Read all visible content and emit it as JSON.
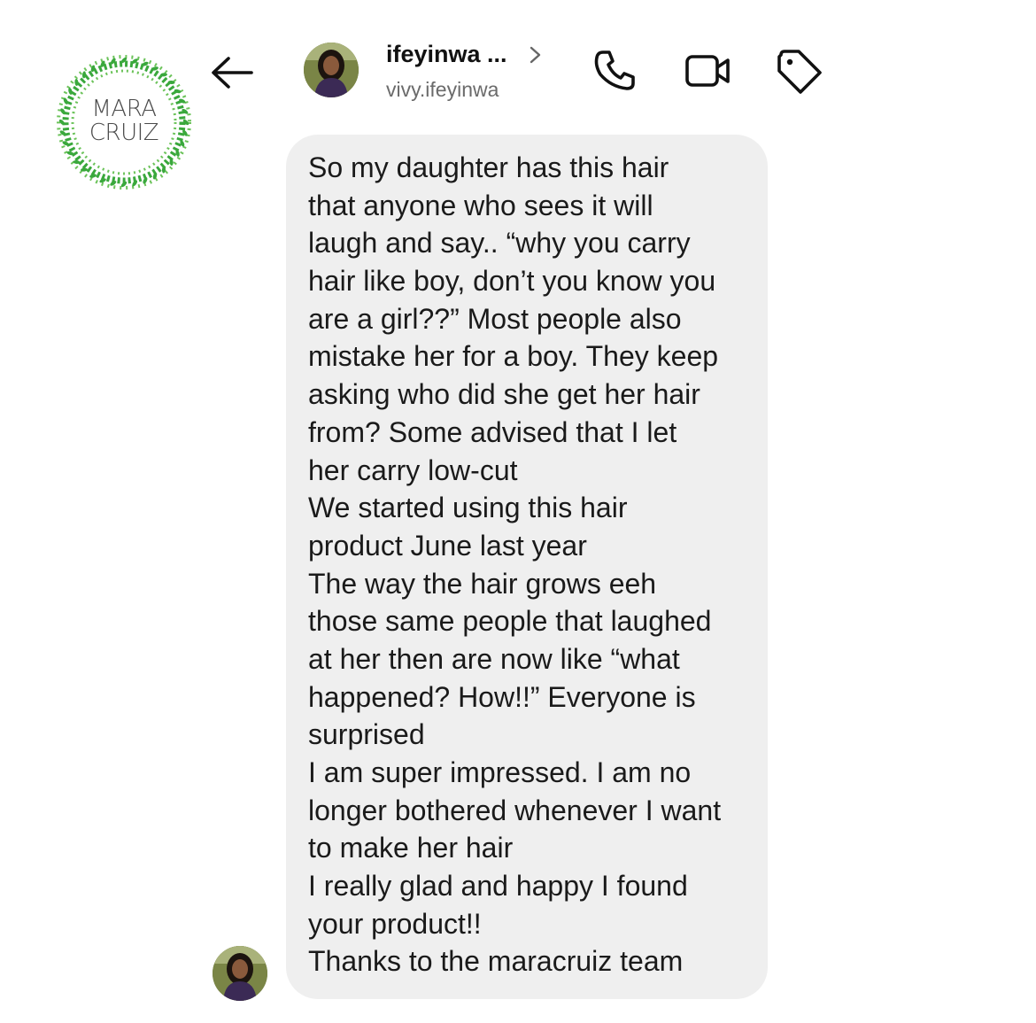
{
  "brand": {
    "logo_text_line1": "MARA",
    "logo_text_line2": "CRUIZ",
    "accent_color": "#3aa83c"
  },
  "header": {
    "back_icon": "arrow-left-icon",
    "contact_name": "ifeyinwa ...",
    "contact_username": "vivy.ifeyinwa",
    "chevron_icon": "chevron-right-icon",
    "call_icon": "phone-icon",
    "video_icon": "video-camera-icon",
    "tag_icon": "tag-icon"
  },
  "message": {
    "sender": "vivy.ifeyinwa",
    "lines": [
      "So my daughter has this hair",
      "that anyone who sees it will",
      "laugh and say.. “why you carry",
      "hair like boy, don’t you know you",
      "are a girl??” Most people also",
      "mistake her for a boy. They keep",
      "asking who did she get her hair",
      "from? Some advised that I let",
      "her carry low-cut",
      "We started using this hair",
      "product June last year",
      "The way the hair grows eeh",
      "those same people that laughed",
      "at her then are now like “what",
      "happened? How!!” Everyone is",
      "surprised",
      "I am super impressed. I am no",
      "longer bothered whenever I want",
      "to make her hair",
      "I really glad and happy I found",
      "your product!!",
      "Thanks to the maracruiz team"
    ]
  }
}
